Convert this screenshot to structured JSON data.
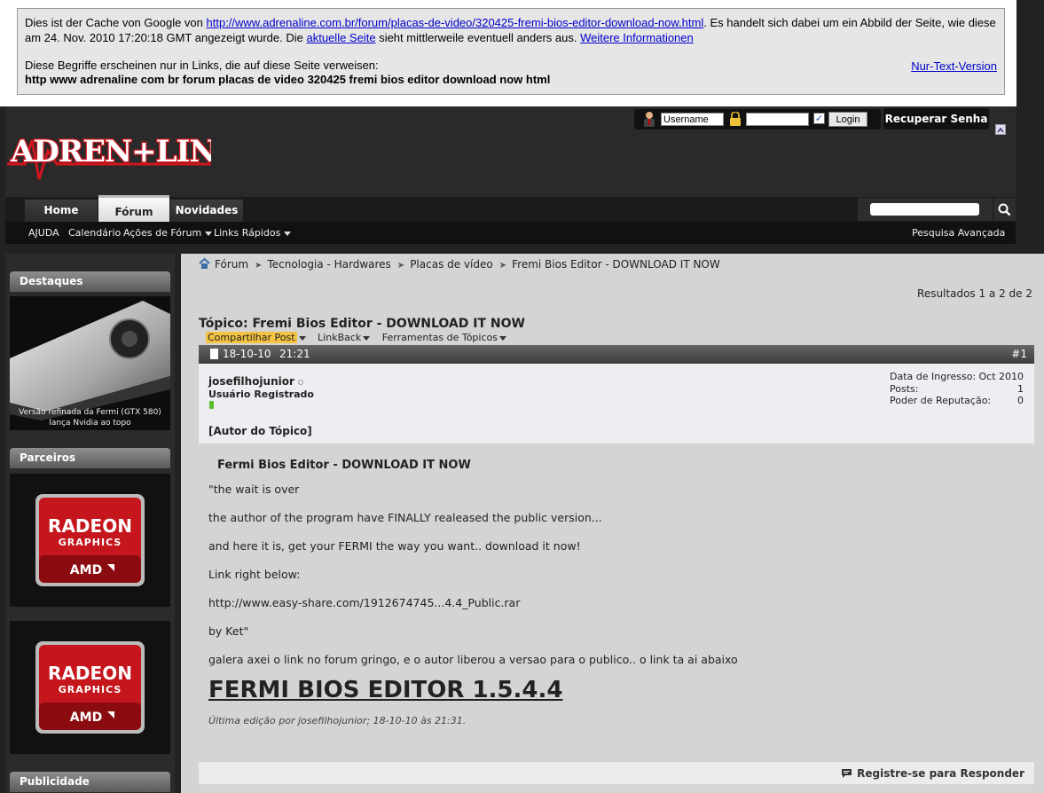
{
  "cache_banner": {
    "intro": "Dies ist der Cache von Google von",
    "url": "http://www.adrenaline.com.br/forum/placas-de-video/320425-fremi-bios-editor-download-now.html",
    "text_a": ". Es handelt sich dabei um ein Abbild der Seite, wie diese am 24. Nov. 2010 17:20:18 GMT angezeigt wurde. Die",
    "current_page_link": "aktuelle Seite",
    "text_b": "sieht mittlerweile eventuell anders aus.",
    "more_info_link": "Weitere Informationen",
    "terms_note": "Diese Begriffe erscheinen nur in Links, die auf diese Seite verweisen:",
    "terms": "http www adrenaline com br forum placas de video 320425 fremi bios editor download now html",
    "text_only_link": "Nur-Text-Version"
  },
  "header": {
    "logo_text": "ADRENALINE",
    "username_value": "Username",
    "password_value": "",
    "remember_checked": true,
    "login_label": "Login",
    "recover_label": "Recuperar Senha"
  },
  "nav": {
    "tabs": [
      "Home",
      "Fórum",
      "Novidades"
    ],
    "active_tab": "Fórum",
    "search_value": ""
  },
  "subnav": {
    "items": [
      "AJUDA",
      "Calendário",
      "Ações de Fórum",
      "Links Rápidos"
    ],
    "advanced_search": "Pesquisa Avançada"
  },
  "sidebar": {
    "highlights_title": "Destaques",
    "highlight_caption_1": "Versão refinada da Fermi (GTX 580)",
    "highlight_caption_2": "lança Nvidia ao topo",
    "partners_title": "Parceiros",
    "partner_logo_line1": "RADEON",
    "partner_logo_line2": "GRAPHICS",
    "partner_logo_line3": "AMD",
    "ads_title": "Publicidade"
  },
  "breadcrumb": [
    "Fórum",
    "Tecnologia - Hardwares",
    "Placas de vídeo",
    "Fremi Bios Editor - DOWNLOAD IT NOW"
  ],
  "results": "Resultados 1 a 2 de 2",
  "topic": {
    "title": "Tópico: Fremi Bios Editor - DOWNLOAD IT NOW",
    "tools": [
      "Compartilhar Post",
      "LinkBack",
      "Ferramentas de Tópicos"
    ]
  },
  "post": {
    "date": "18-10-10",
    "time": "21:21",
    "number": "#1",
    "username": "josefilhojunior",
    "user_title": "Usuário Registrado",
    "author_tag": "[Autor do Tópico]",
    "stats": [
      {
        "label": "Data de Ingresso:",
        "value": "Oct 2010"
      },
      {
        "label": "Posts:",
        "value": "1"
      },
      {
        "label": "Poder de Reputação:",
        "value": "0"
      }
    ],
    "title": "Fermi Bios Editor - DOWNLOAD IT NOW",
    "lines": [
      "\"the wait is over",
      "the author of the program have FINALLY realeased the public version...",
      "and here it is, get your FERMI the way you want.. download it now!",
      "Link right below:",
      "http://www.easy-share.com/1912674745...4.4_Public.rar",
      "by Ket\"",
      "galera axei o link no forum gringo, e o autor liberou a versao para o publico.. o link ta ai abaixo"
    ],
    "download_link": "FERMI BIOS EDITOR 1.5.4.4",
    "edit_note": "Última edição por josefilhojunior; 18-10-10 às 21:31.",
    "reply_label": "Registre-se para Responder"
  },
  "colors": {
    "accent_share": "#f3c341",
    "logo_red": "#d0151e",
    "link_blue": "#0000cc"
  }
}
